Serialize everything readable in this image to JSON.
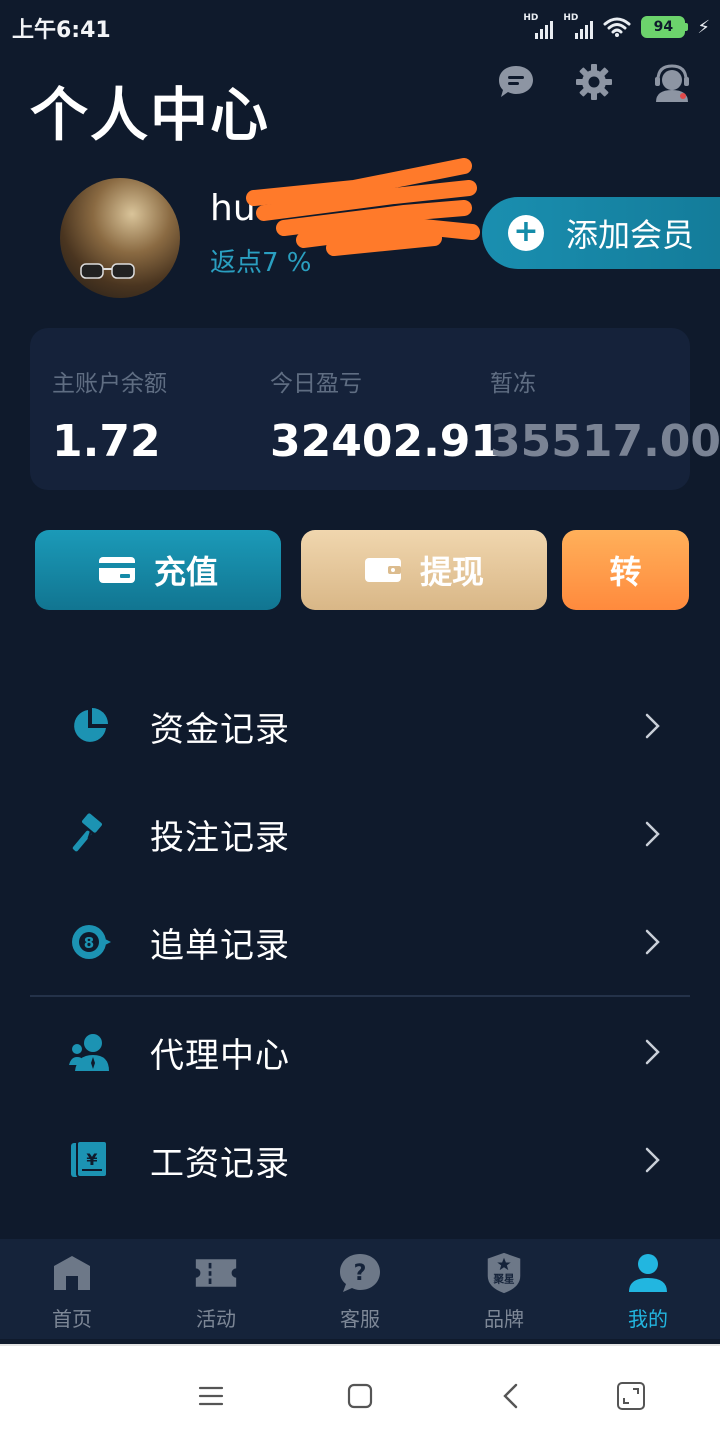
{
  "status_bar": {
    "time": "上午6:41",
    "signal1_label": "HD",
    "signal2_label": "HD",
    "battery": "94"
  },
  "header": {
    "title": "个人中心",
    "icons": [
      "message-icon",
      "settings-icon",
      "customer-service-icon"
    ]
  },
  "profile": {
    "username": "hu",
    "rebate": "返点7  %",
    "add_member_label": "添加会员"
  },
  "balances": [
    {
      "label": "主账户余额",
      "value": "1.72"
    },
    {
      "label": "今日盈亏",
      "value": "32402.91"
    },
    {
      "label": "暂冻",
      "value": "35517.00"
    }
  ],
  "actions": {
    "recharge": "充值",
    "withdraw": "提现",
    "transfer": "转"
  },
  "menu": [
    {
      "label": "资金记录",
      "icon": "pie-chart-icon"
    },
    {
      "label": "投注记录",
      "icon": "gavel-icon"
    },
    {
      "label": "追单记录",
      "icon": "eight-ball-icon"
    },
    {
      "label": "代理中心",
      "icon": "agent-icon"
    },
    {
      "label": "工资记录",
      "icon": "salary-receipt-icon"
    }
  ],
  "bottom_nav": [
    {
      "label": "首页",
      "icon": "home-icon"
    },
    {
      "label": "活动",
      "icon": "ticket-icon"
    },
    {
      "label": "客服",
      "icon": "help-bubble-icon"
    },
    {
      "label": "品牌",
      "icon": "brand-badge-icon",
      "badge_text": "聚星"
    },
    {
      "label": "我的",
      "icon": "user-icon",
      "active": true
    }
  ],
  "colors": {
    "background": "#0f1a2c",
    "accent": "#1a8fb0",
    "active_nav": "#22b6e0",
    "withdraw": "#e6c79a",
    "transfer": "#ff9a47",
    "scribble": "#ff7a2a"
  }
}
